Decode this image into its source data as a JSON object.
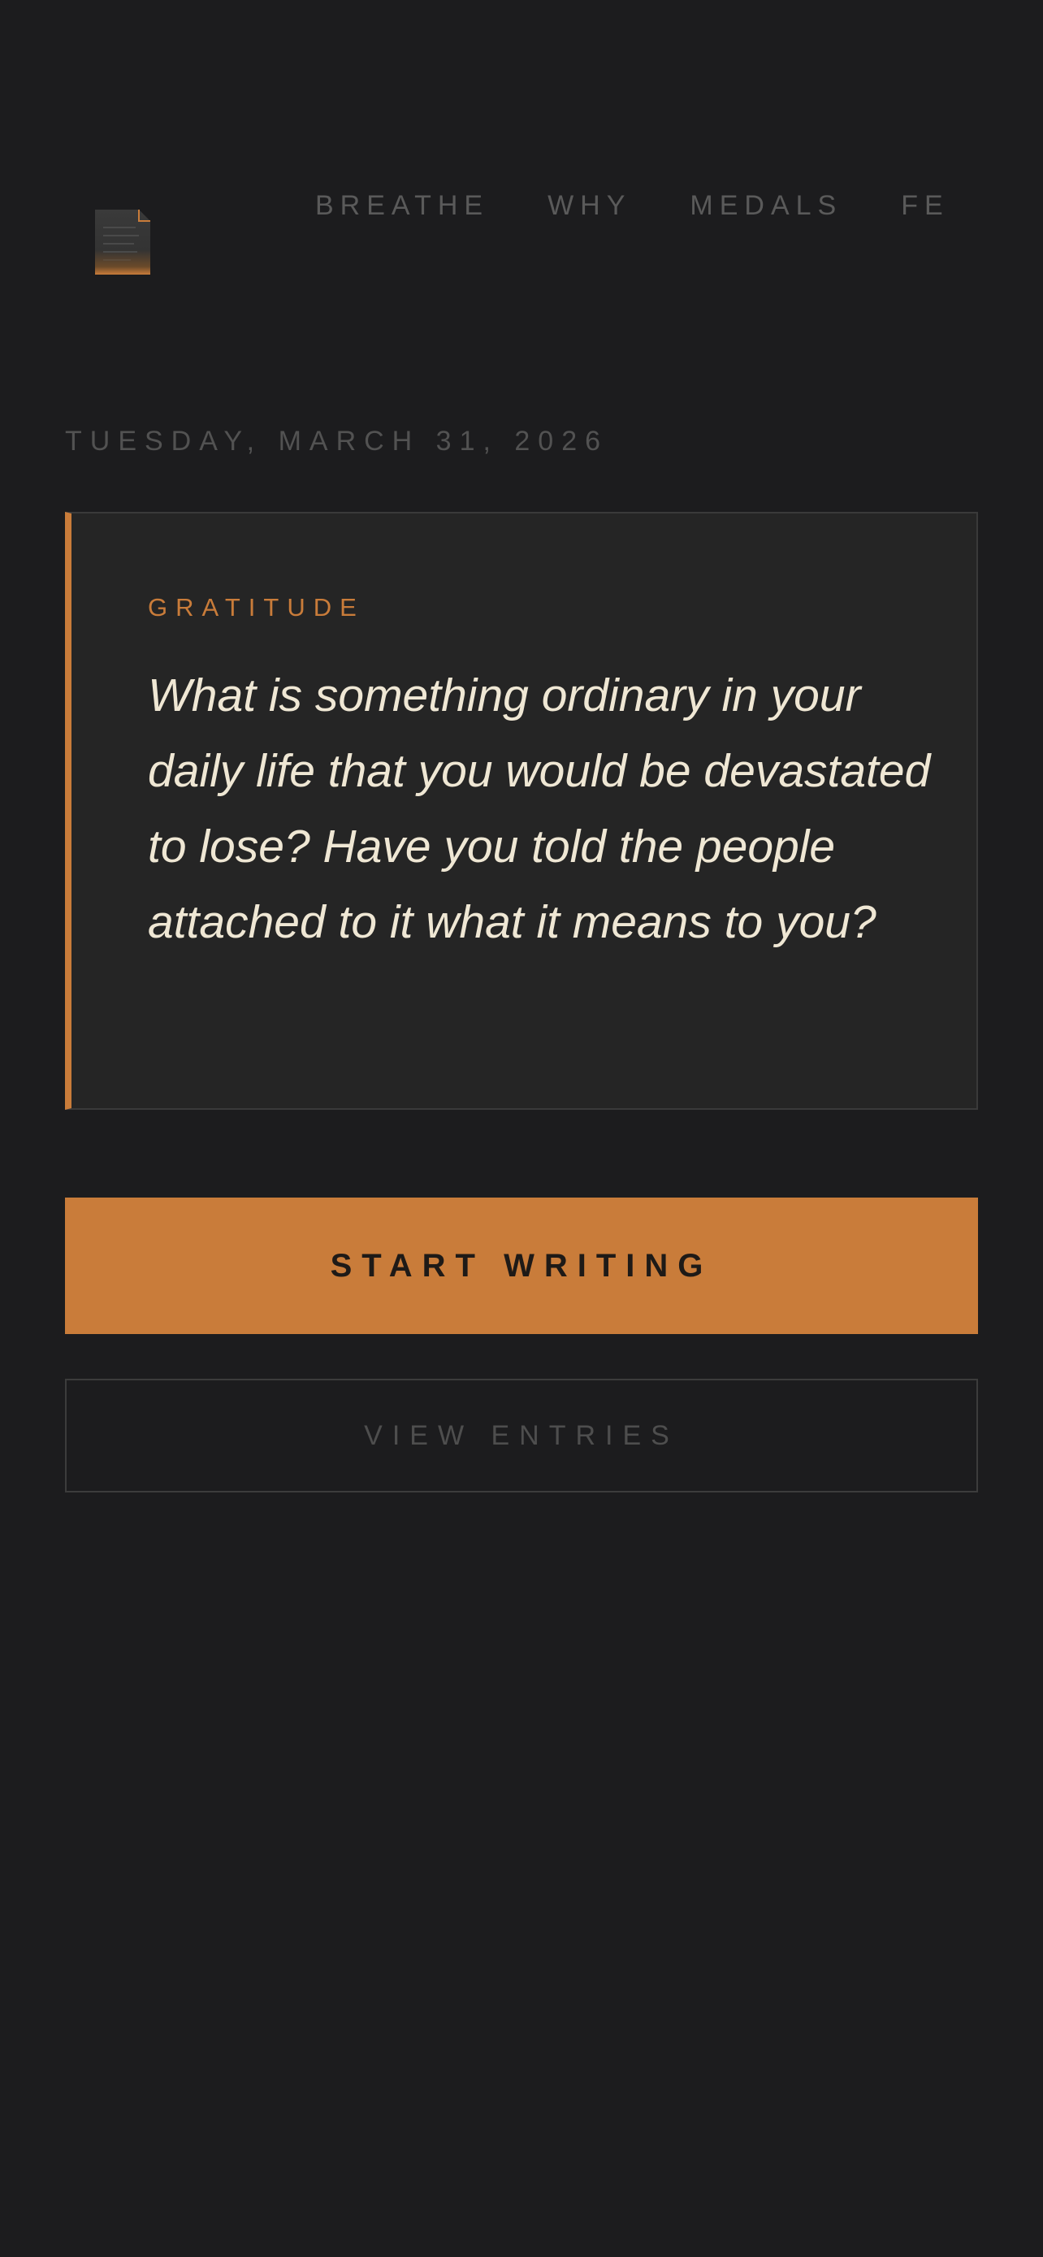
{
  "app": {
    "logo_icon": "journal-page-icon"
  },
  "nav": {
    "items": [
      {
        "label": "BREATHE"
      },
      {
        "label": "WHY"
      },
      {
        "label": "MEDALS"
      },
      {
        "label": "FE"
      }
    ]
  },
  "date": "TUESDAY, MARCH 31, 2026",
  "prompt_card": {
    "category": "GRATITUDE",
    "text": "What is something ordinary in your daily life that you would be devastated to lose? Have you told the people attached to it what it means to you?"
  },
  "actions": {
    "start_label": "START WRITING",
    "view_label": "VIEW ENTRIES"
  },
  "colors": {
    "background": "#1c1c1e",
    "accent": "#c97c3a",
    "card": "#252525",
    "prompt_text": "#efe7d4",
    "muted_text": "#5a5a5a"
  }
}
